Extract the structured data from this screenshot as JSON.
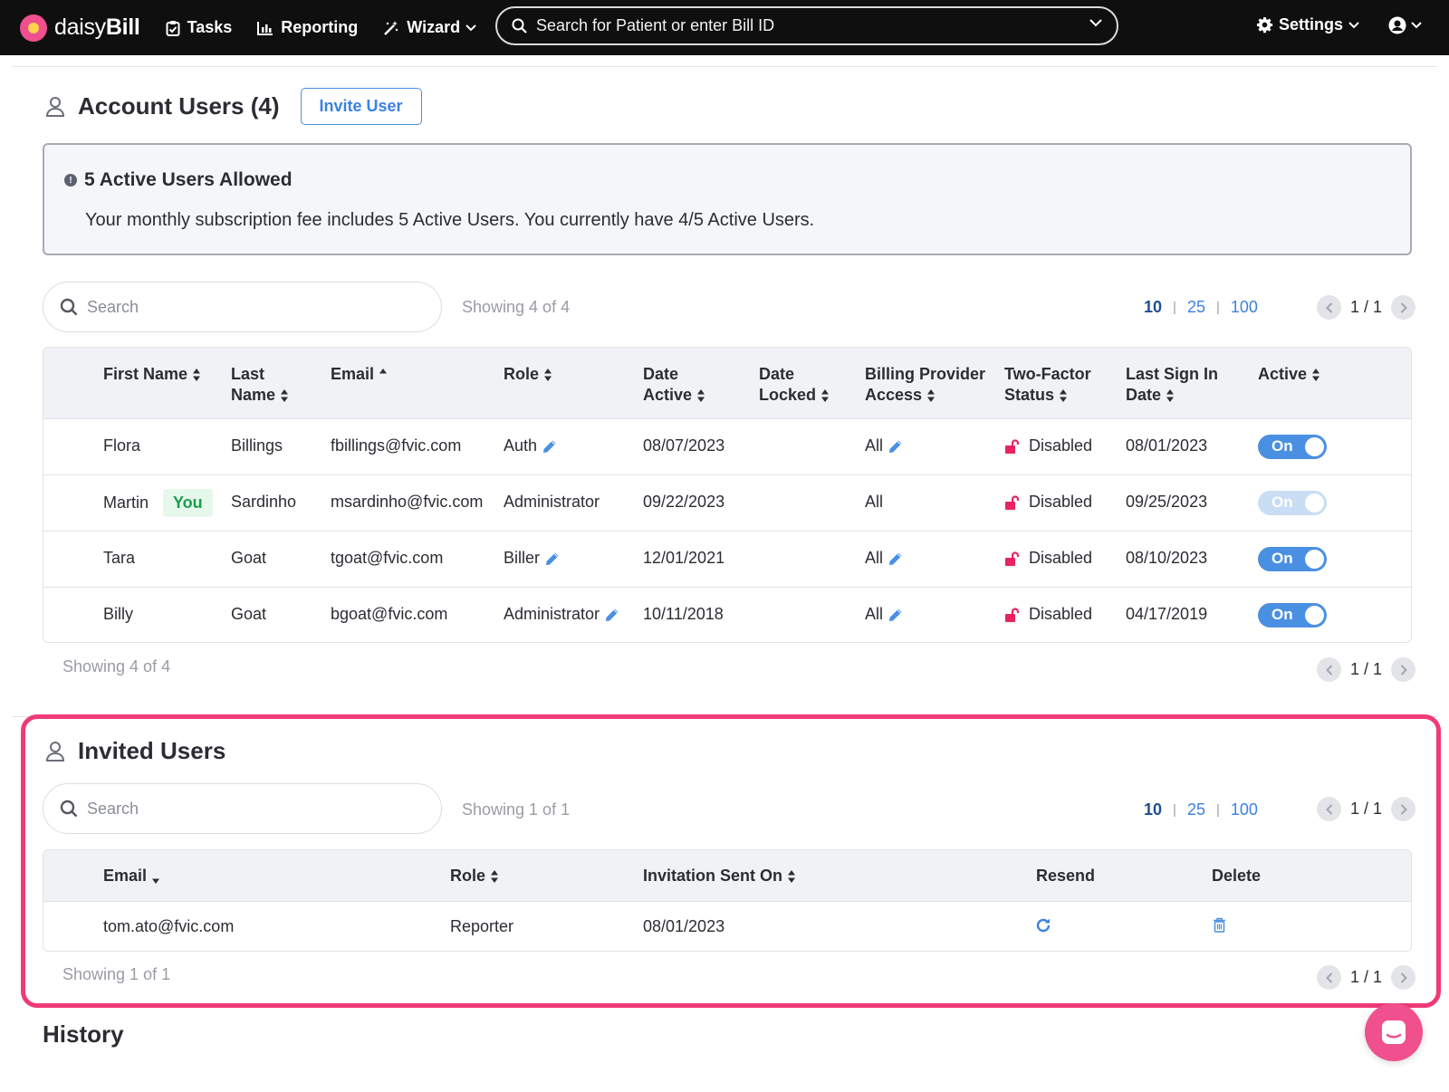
{
  "nav": {
    "brand_plain": "daisy",
    "brand_bold": "Bill",
    "tasks": "Tasks",
    "reporting": "Reporting",
    "wizard": "Wizard",
    "search_placeholder": "Search for Patient or enter Bill ID",
    "settings": "Settings"
  },
  "account_users": {
    "title": "Account Users (4)",
    "invite_button": "Invite User",
    "notice_title": "5 Active Users Allowed",
    "notice_body": "Your monthly subscription fee includes 5 Active Users. You currently have 4/5 Active Users.",
    "search_placeholder": "Search",
    "showing_top": "Showing 4 of 4",
    "showing_bottom": "Showing 4 of 4",
    "page_sizes": [
      "10",
      "25",
      "100"
    ],
    "pager": "1 / 1",
    "columns": {
      "first_name": "First Name",
      "last_name_1": "Last",
      "last_name_2": "Name",
      "email": "Email",
      "role": "Role",
      "date_active_1": "Date",
      "date_active_2": "Active",
      "date_locked_1": "Date",
      "date_locked_2": "Locked",
      "billing_1": "Billing Provider",
      "billing_2": "Access",
      "twofactor_1": "Two-Factor",
      "twofactor_2": "Status",
      "lastsign_1": "Last Sign In",
      "lastsign_2": "Date",
      "active": "Active"
    },
    "rows": [
      {
        "first": "Flora",
        "you": "",
        "last": "Billings",
        "email": "fbillings@fvic.com",
        "role": "Auth",
        "role_editable": true,
        "date_active": "08/07/2023",
        "date_locked": "",
        "billing": "All",
        "billing_editable": true,
        "twofactor": "Disabled",
        "last_sign": "08/01/2023",
        "active": "On",
        "active_enabled": true
      },
      {
        "first": "Martin",
        "you": "You",
        "last": "Sardinho",
        "email": "msardinho@fvic.com",
        "role": "Administrator",
        "role_editable": false,
        "date_active": "09/22/2023",
        "date_locked": "",
        "billing": "All",
        "billing_editable": false,
        "twofactor": "Disabled",
        "last_sign": "09/25/2023",
        "active": "On",
        "active_enabled": false
      },
      {
        "first": "Tara",
        "you": "",
        "last": "Goat",
        "email": "tgoat@fvic.com",
        "role": "Biller",
        "role_editable": true,
        "date_active": "12/01/2021",
        "date_locked": "",
        "billing": "All",
        "billing_editable": true,
        "twofactor": "Disabled",
        "last_sign": "08/10/2023",
        "active": "On",
        "active_enabled": true
      },
      {
        "first": "Billy",
        "you": "",
        "last": "Goat",
        "email": "bgoat@fvic.com",
        "role": "Administrator",
        "role_editable": true,
        "date_active": "10/11/2018",
        "date_locked": "",
        "billing": "All",
        "billing_editable": true,
        "twofactor": "Disabled",
        "last_sign": "04/17/2019",
        "active": "On",
        "active_enabled": true
      }
    ]
  },
  "invited_users": {
    "title": "Invited Users",
    "search_placeholder": "Search",
    "showing_top": "Showing 1 of 1",
    "showing_bottom": "Showing 1 of 1",
    "page_sizes": [
      "10",
      "25",
      "100"
    ],
    "pager": "1 / 1",
    "columns": {
      "email": "Email",
      "role": "Role",
      "sent_on": "Invitation Sent On",
      "resend": "Resend",
      "delete": "Delete"
    },
    "rows": [
      {
        "email": "tom.ato@fvic.com",
        "role": "Reporter",
        "sent_on": "08/01/2023"
      }
    ]
  },
  "history": {
    "title": "History"
  },
  "colors": {
    "accent": "#4a90e2",
    "highlight_frame": "#ef3a79",
    "lock": "#e8245f",
    "you_badge": "#1b9e4b"
  }
}
